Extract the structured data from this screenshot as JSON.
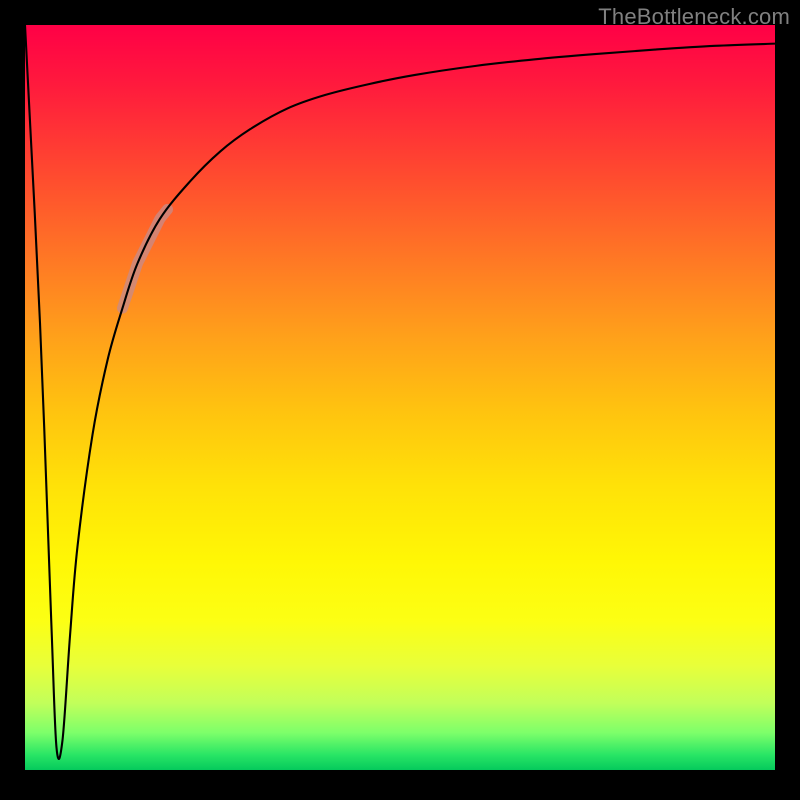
{
  "watermark": {
    "text": "TheBottleneck.com"
  },
  "colors": {
    "frame": "#000000",
    "curve": "#000000",
    "highlight": "#c98a87",
    "watermark": "#808080"
  },
  "chart_data": {
    "type": "line",
    "title": "",
    "xlabel": "",
    "ylabel": "",
    "xlim": [
      0,
      100
    ],
    "ylim": [
      0,
      100
    ],
    "grid": false,
    "legend": false,
    "series": [
      {
        "name": "bottleneck-curve",
        "x": [
          0,
          2,
          3.5,
          4.2,
          5,
          6,
          7,
          9,
          11,
          13,
          15,
          18,
          22,
          26,
          30,
          35,
          40,
          46,
          52,
          60,
          68,
          76,
          84,
          92,
          100
        ],
        "y": [
          100,
          60,
          20,
          3,
          4,
          18,
          30,
          45,
          55,
          62,
          68,
          74,
          79,
          83,
          86,
          88.8,
          90.6,
          92.1,
          93.3,
          94.5,
          95.4,
          96.1,
          96.7,
          97.2,
          97.5
        ],
        "note": "x is relative performance axis (0-100), y is bottleneck level (0=green bottom, 100=red top). Start at top-left, sharp V down near x≈4, then logarithmic rise toward upper-right asymptote."
      },
      {
        "name": "highlighted-segment",
        "x": [
          13,
          19
        ],
        "y": [
          62,
          75
        ],
        "note": "Thick pale-rose overlay on portion of the rising curve."
      }
    ]
  }
}
